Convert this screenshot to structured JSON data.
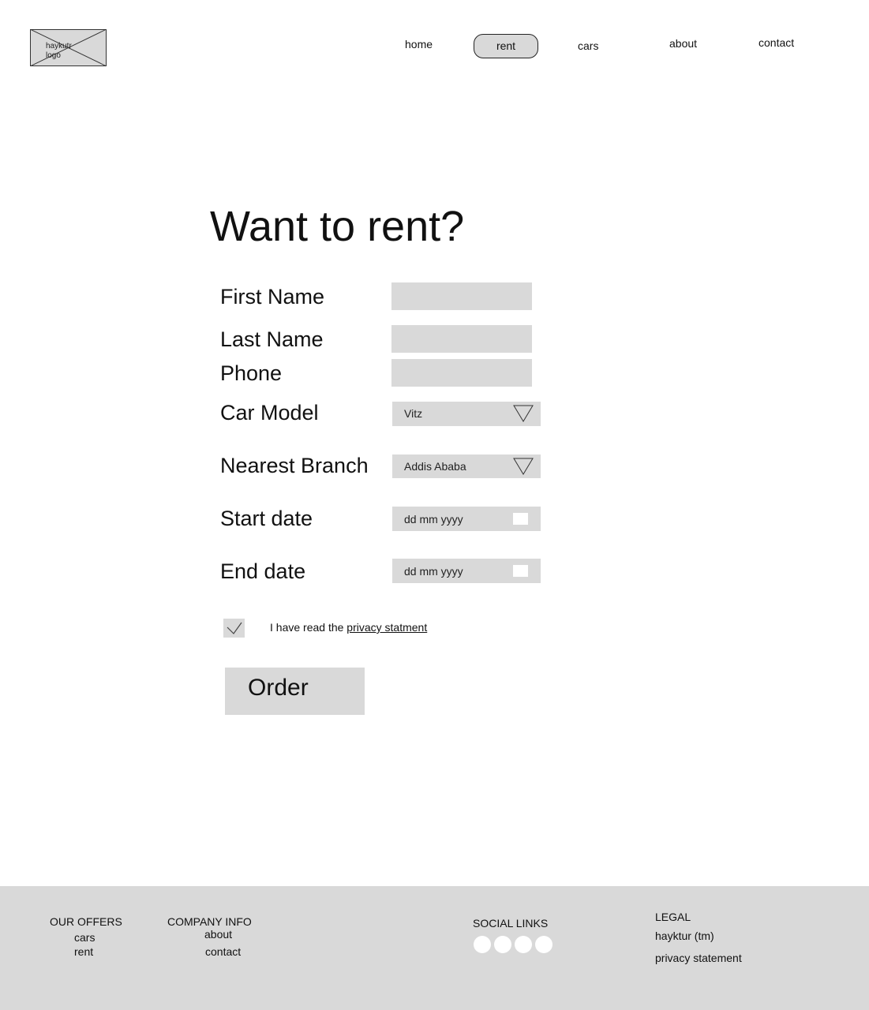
{
  "header": {
    "logo_text": "haykutr\nlogo",
    "nav": {
      "home": "home",
      "rent": "rent",
      "cars": "cars",
      "about": "about",
      "contact": "contact"
    }
  },
  "main": {
    "title": "Want to rent?",
    "form": {
      "first_name_label": "First Name",
      "last_name_label": "Last Name",
      "phone_label": "Phone",
      "car_model_label": "Car Model",
      "car_model_value": "Vitz",
      "nearest_branch_label": "Nearest Branch",
      "nearest_branch_value": "Addis Ababa",
      "start_date_label": "Start date",
      "start_date_placeholder": "dd mm yyyy",
      "end_date_label": "End date",
      "end_date_placeholder": "dd mm yyyy",
      "consent_text": "I have read the",
      "consent_link": "privacy statment",
      "consent_checked": true,
      "order_label": "Order"
    }
  },
  "footer": {
    "our_offers": {
      "heading": "OUR OFFERS",
      "links": [
        "cars",
        "rent"
      ]
    },
    "company_info": {
      "heading": "COMPANY INFO",
      "links": [
        "about",
        "contact"
      ]
    },
    "social_links": {
      "heading": "SOCIAL LINKS"
    },
    "legal": {
      "heading": "LEGAL",
      "links": [
        "hayktur (tm)",
        "privacy statement"
      ]
    }
  },
  "colors": {
    "placeholder_gray": "#d9d9d9",
    "background": "#ffffff",
    "text": "#111111"
  }
}
